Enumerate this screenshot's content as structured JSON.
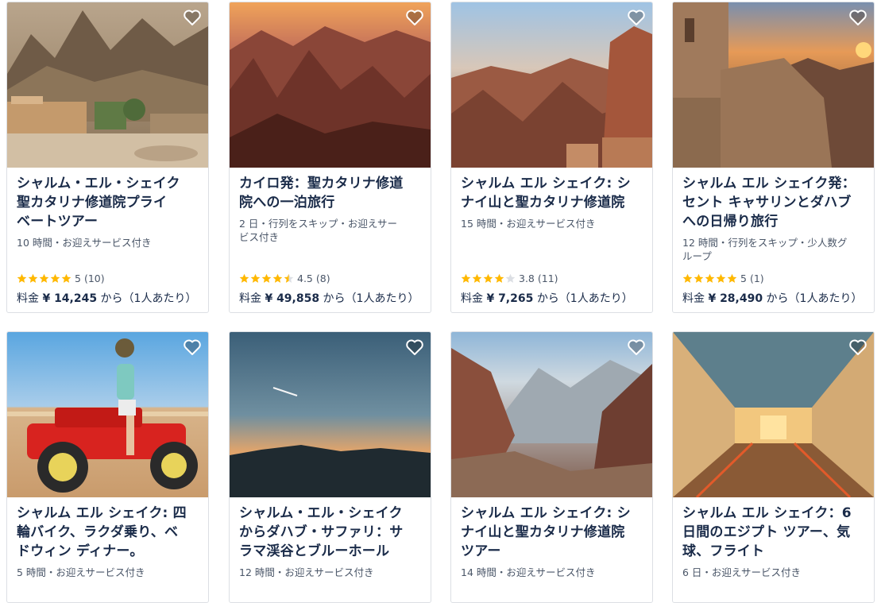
{
  "colors": {
    "star": "#ffb800",
    "star_empty": "#dcdfe4",
    "heading": "#1a2b49",
    "meta": "#4a5668"
  },
  "cards": [
    {
      "title": "シャルム・エル・シェイク 聖カタリナ修道院プライベートツアー",
      "title_lines": [
        "シャルム・エル・シェイク",
        "聖カタリナ修道院プライ",
        "ベートツアー"
      ],
      "meta": "10 時間・お迎えサービス付き",
      "rating": "5",
      "reviews": "(10)",
      "stars": 5,
      "price_prefix": "料金",
      "price": "¥ 14,245",
      "price_suffix": "から（1人あたり）",
      "image": "monastery-in-desert-valley"
    },
    {
      "title": "カイロ発：聖カタリナ修道院への一泊旅行",
      "title_lines": [
        "カイロ発：聖カタリナ修道",
        "院への一泊旅行"
      ],
      "meta": "2 日・行列をスキップ・お迎えサービス付き",
      "meta_lines": [
        "2 日・行列をスキップ・お迎えサー",
        "ビス付き"
      ],
      "rating": "4.5",
      "reviews": "(8)",
      "stars": 4.5,
      "price_prefix": "料金",
      "price": "¥ 49,858",
      "price_suffix": "から（1人あたり）",
      "image": "sunrise-mountains"
    },
    {
      "title": "シャルム エル シェイク: シナイ山と聖カタリナ修道院",
      "title_lines": [
        "シャルム エル シェイク: シ",
        "ナイ山と聖カタリナ修道院"
      ],
      "meta": "15 時間・お迎えサービス付き",
      "rating": "3.8",
      "reviews": "(11)",
      "stars": 3.8,
      "price_prefix": "料金",
      "price": "¥ 7,265",
      "price_suffix": "から（1人あたり）",
      "image": "mount-sinai-peaks"
    },
    {
      "title": "シャルム エル シェイク発：セント キャサリンとダハブへの日帰り旅行",
      "title_lines": [
        "シャルム エル シェイク発：",
        "セント キャサリンとダハブ",
        "への日帰り旅行"
      ],
      "meta": "12 時間・行列をスキップ・少人数グループ",
      "meta_lines": [
        "12 時間・行列をスキップ・少人数グ",
        "ループ"
      ],
      "rating": "5",
      "reviews": "(1)",
      "stars": 5,
      "price_prefix": "料金",
      "price": "¥ 28,490",
      "price_suffix": "から（1人あたり）",
      "image": "chapel-at-sunset"
    },
    {
      "title": "シャルム エル シェイク: 四輪バイク、ラクダ乗り、ベドウィン ディナー。",
      "title_lines": [
        "シャルム エル シェイク: 四",
        "輪バイク、ラクダ乗り、ベ",
        "ドウィン ディナー。"
      ],
      "meta": "5 時間・お迎えサービス付き",
      "image": "quad-bike-rider"
    },
    {
      "title": "シャルム・エル・シェイクからダハブ・サファリ：サラマ渓谷とブルーホール",
      "title_lines": [
        "シャルム・エル・シェイク",
        "からダハブ・サファリ：サ",
        "ラマ渓谷とブルーホール"
      ],
      "meta": "12 時間・お迎えサービス付き",
      "image": "dusk-sky-silhouette"
    },
    {
      "title": "シャルム エル シェイク: シナイ山と聖カタリナ修道院ツアー",
      "title_lines": [
        "シャルム エル シェイク: シ",
        "ナイ山と聖カタリナ修道院",
        "ツアー"
      ],
      "meta": "14 時間・お迎えサービス付き",
      "image": "rocky-canyon"
    },
    {
      "title": "シャルム エル シェイク：6 日間のエジプト ツアー、気球、フライト",
      "title_lines": [
        "シャルム エル シェイク：6",
        "日間のエジプト ツアー、気",
        "球、フライト"
      ],
      "meta": "6 日・お迎えサービス付き",
      "image": "egyptian-tomb-corridor"
    }
  ]
}
